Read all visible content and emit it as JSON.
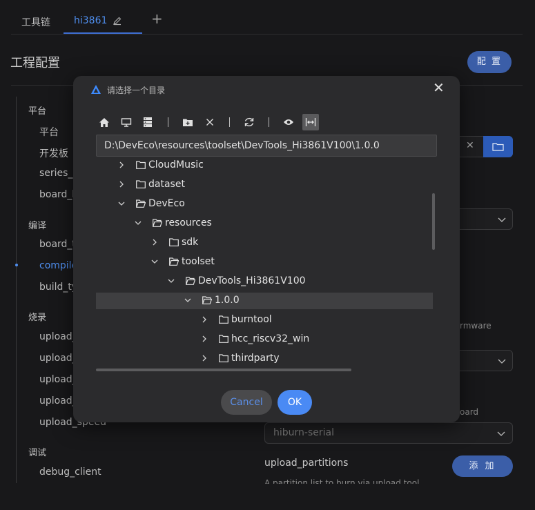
{
  "tabs": [
    {
      "label": "工具链"
    },
    {
      "label": "hi3861"
    }
  ],
  "header": {
    "title": "工程配置",
    "config_button": "配 置"
  },
  "nav": {
    "groups": [
      "平台",
      "编译",
      "烧录",
      "调试"
    ],
    "items": [
      "平台",
      "开发板",
      "series_n",
      "board_b",
      "board_t",
      "compile",
      "build_ty",
      "upload_",
      "upload_",
      "upload_",
      "upload_",
      "upload_speed",
      "debug_client"
    ]
  },
  "right": {
    "hint_firmware": "rmware",
    "hint_board": "oard",
    "protocol_value": "hiburn-serial",
    "upload_partitions_label": "upload_partitions",
    "add_button": "添 加",
    "partition_hint": "A partition list to burn via upload tool"
  },
  "dialog": {
    "title": "请选择一个目录",
    "path": "D:\\DevEco\\resources\\toolset\\DevTools_Hi3861V100\\1.0.0",
    "tree": [
      {
        "name": "CloudMusic",
        "expanded": false
      },
      {
        "name": "dataset",
        "expanded": false
      },
      {
        "name": "DevEco",
        "expanded": true
      },
      {
        "name": "resources",
        "expanded": true
      },
      {
        "name": "sdk",
        "expanded": false
      },
      {
        "name": "toolset",
        "expanded": true
      },
      {
        "name": "DevTools_Hi3861V100",
        "expanded": true
      },
      {
        "name": "1.0.0",
        "expanded": true,
        "selected": true
      },
      {
        "name": "burntool",
        "expanded": false
      },
      {
        "name": "hcc_riscv32_win",
        "expanded": false
      },
      {
        "name": "thirdparty",
        "expanded": false
      }
    ],
    "cancel": "Cancel",
    "ok": "OK"
  },
  "colors": {
    "accent": "#4f8ff0",
    "button": "#3b5ea8",
    "ok": "#4a8af4",
    "dialog_bg": "#2b2b2d",
    "page_bg": "#18181a"
  }
}
